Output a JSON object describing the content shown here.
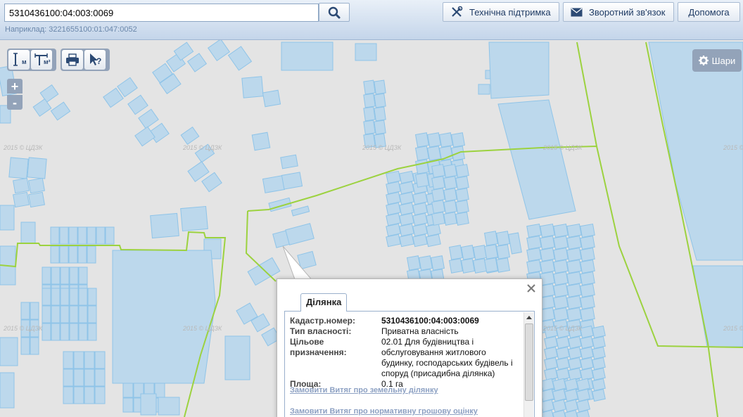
{
  "search": {
    "value": "5310436100:04:003:0069",
    "hint": "Наприклад: 3221655100:01:047:0052"
  },
  "header": {
    "support_label": "Технічна підтримка",
    "feedback_label": "Зворотний зв'язок",
    "help_label": "Допомога"
  },
  "map_controls": {
    "zoom_in": "+",
    "zoom_out": "-",
    "layers_label": "Шари",
    "measure_length_sub": "м",
    "measure_area_sub": "м²",
    "identify_sub": "?"
  },
  "watermark": "2015 © ЦДЗК",
  "popup": {
    "tab_label": "Ділянка",
    "fields": [
      {
        "label": "Кадастр.номер:",
        "value": "5310436100:04:003:0069"
      },
      {
        "label": "Тип власності:",
        "value": "Приватна власність"
      },
      {
        "label": "Цільове призначення:",
        "value": "02.01 Для будівництва і обслуговування житлового будинку, господарських будівель і споруд (присадибна ділянка)"
      },
      {
        "label": "Площа:",
        "value": "0.1 га"
      }
    ],
    "link1": "Замовити Витяг про земельну ділянку",
    "link2": "Замовити Витяг про нормативну грошову оцінку"
  },
  "colors": {
    "parcel_fill": "#bcd8ec",
    "parcel_stroke": "#8fc4e8",
    "boundary": "#9cd23f",
    "map_bg": "#e4e4e4",
    "control": "#93a3b9"
  }
}
